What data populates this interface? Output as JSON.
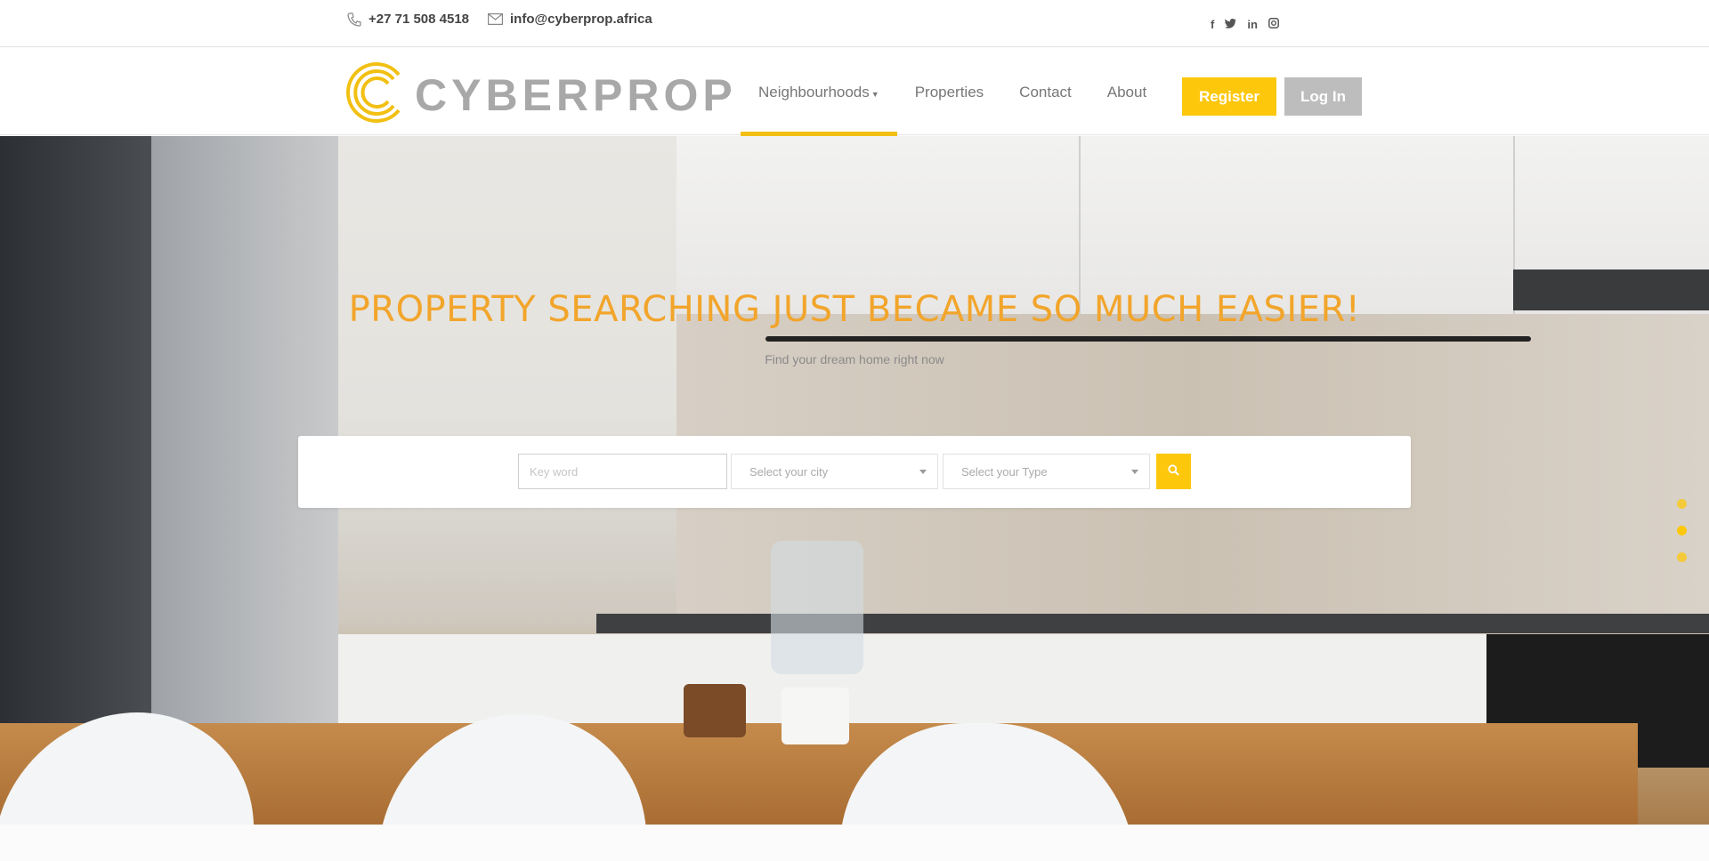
{
  "topbar": {
    "phone": "+27 71 508 4518",
    "email": "info@cyberprop.africa",
    "socials": [
      {
        "icon": "facebook-icon",
        "glyph": "f"
      },
      {
        "icon": "twitter-icon",
        "glyph": "t"
      },
      {
        "icon": "linkedin-icon",
        "glyph": "in"
      },
      {
        "icon": "instagram-icon",
        "glyph": "◘"
      }
    ]
  },
  "brand": {
    "name": "CYBERPROP",
    "logo_icon": "cyberprop-rings-logo",
    "color": "#f2c012"
  },
  "nav": {
    "items": [
      {
        "label": "Neighbourhoods",
        "active": true,
        "dropdown": true
      },
      {
        "label": "Properties"
      },
      {
        "label": "Contact"
      },
      {
        "label": "About"
      }
    ],
    "register_label": "Register",
    "login_label": "Log In"
  },
  "hero": {
    "title": "PROPERTY SEARCHING JUST BECAME SO MUCH EASIER!",
    "subtitle": "Find your dream home right now",
    "search": {
      "keyword_placeholder": "Key word",
      "city_placeholder": "Select your city",
      "type_placeholder": "Select your Type",
      "button_icon": "search-icon"
    },
    "slides": 3,
    "active_slide": 2
  },
  "colors": {
    "accent": "#fdc70c",
    "title": "#f2a52b",
    "login": "#bdbdbd"
  }
}
